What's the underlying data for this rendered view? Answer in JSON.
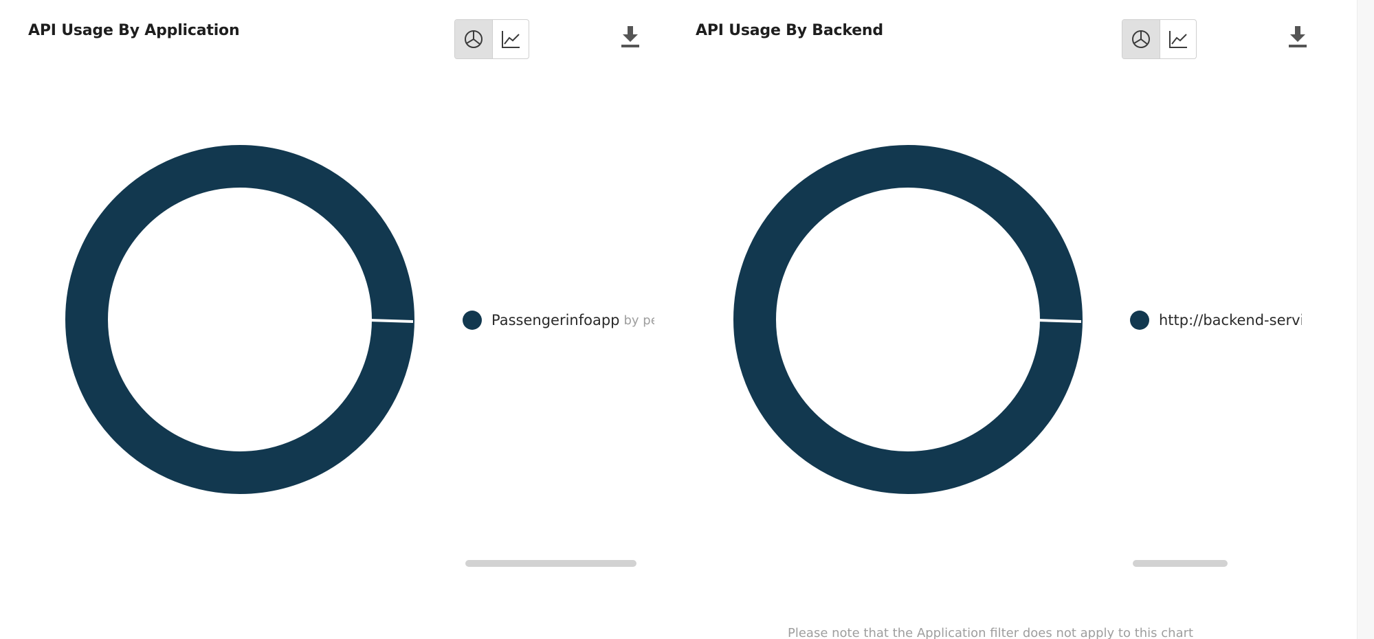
{
  "colors": {
    "series": "#12384f",
    "active_toggle_bg": "#e0e0e0",
    "muted_text": "#9e9e9e"
  },
  "panels": [
    {
      "title": "API Usage By Application",
      "toggle": {
        "options": [
          {
            "icon": "pie-chart-icon",
            "active": true
          },
          {
            "icon": "line-chart-icon",
            "active": false
          }
        ]
      },
      "download_icon": "download-icon",
      "chart_data": {
        "type": "pie",
        "categories": [
          "Passengerinfoapp"
        ],
        "values": [
          100
        ],
        "title": "API Usage By Application"
      },
      "legend": [
        {
          "label": "Passengerinfoapp",
          "sub": "by pe"
        }
      ],
      "note": ""
    },
    {
      "title": "API Usage By Backend",
      "toggle": {
        "options": [
          {
            "icon": "pie-chart-icon",
            "active": true
          },
          {
            "icon": "line-chart-icon",
            "active": false
          }
        ]
      },
      "download_icon": "download-icon",
      "chart_data": {
        "type": "pie",
        "categories": [
          "http://backend-service"
        ],
        "values": [
          100
        ],
        "title": "API Usage By Backend"
      },
      "legend": [
        {
          "label": "http://backend-service",
          "sub": ""
        }
      ],
      "note": "Please note that the Application filter does not apply to this chart"
    }
  ]
}
